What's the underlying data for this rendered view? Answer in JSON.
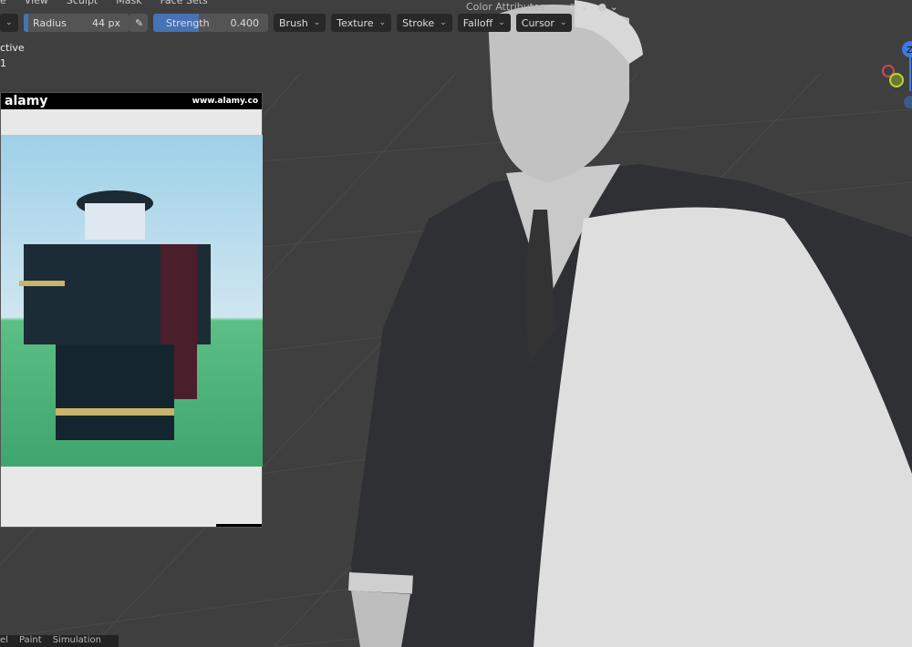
{
  "menubar": {
    "mode_partial": "e",
    "items": [
      "View",
      "Sculpt",
      "Mask",
      "Face Sets"
    ]
  },
  "header_right": {
    "color_attributes": "Color Attributes"
  },
  "toolbar": {
    "radius_label": "Radius",
    "radius_value": "44 px",
    "strength_label": "Strength",
    "strength_value": "0.400",
    "strength_fraction": 0.4,
    "menus": [
      "Brush",
      "Texture",
      "Stroke",
      "Falloff",
      "Cursor"
    ]
  },
  "overlay": {
    "line1": "ctive",
    "line2": "1"
  },
  "reference_image": {
    "watermark_left": "alamy",
    "watermark_right": "www.alamy.co"
  },
  "bottom_tabs": [
    "el",
    "Paint",
    "Simulation"
  ],
  "gizmo": {
    "z_label": "Z"
  },
  "colors": {
    "accent": "#4772b3",
    "background": "#3f3f3f"
  }
}
